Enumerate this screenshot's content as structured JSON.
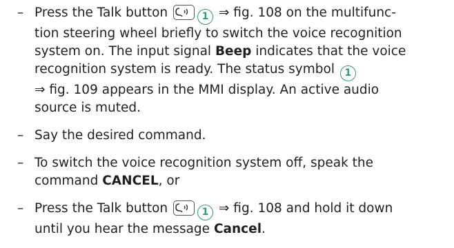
{
  "steps": [
    {
      "pre": "Press the Talk button",
      "callout": "1",
      "post1": "⇒ fig. 108 on the multifunc-",
      "line2": "tion steering wheel briefly to switch the voice recognition",
      "line3_pre": "system on. The input signal",
      "line3_bold": "Beep",
      "line3_post": "indicates that the voice",
      "line4": "recognition system is ready. The status symbol",
      "line4_callout": "1",
      "line5": "⇒ fig. 109 appears in the MMI display. An active audio",
      "line6": "source is muted."
    },
    {
      "text": "Say the desired command."
    },
    {
      "line1": "To switch the voice recognition system off, speak the",
      "line2_pre": "command",
      "line2_bold": "CANCEL",
      "line2_post": ", or"
    },
    {
      "pre": "Press the Talk button",
      "callout": "1",
      "post1": "⇒ fig. 108 and hold it down",
      "line2_pre": "until you hear the message",
      "line2_bold": "Cancel",
      "line2_post": "."
    }
  ],
  "dash": "–",
  "icons": {
    "talk": "talk-button-icon",
    "callout": "callout-number-icon"
  },
  "colors": {
    "callout": "#2e9a76",
    "text": "#1f1f1f"
  }
}
